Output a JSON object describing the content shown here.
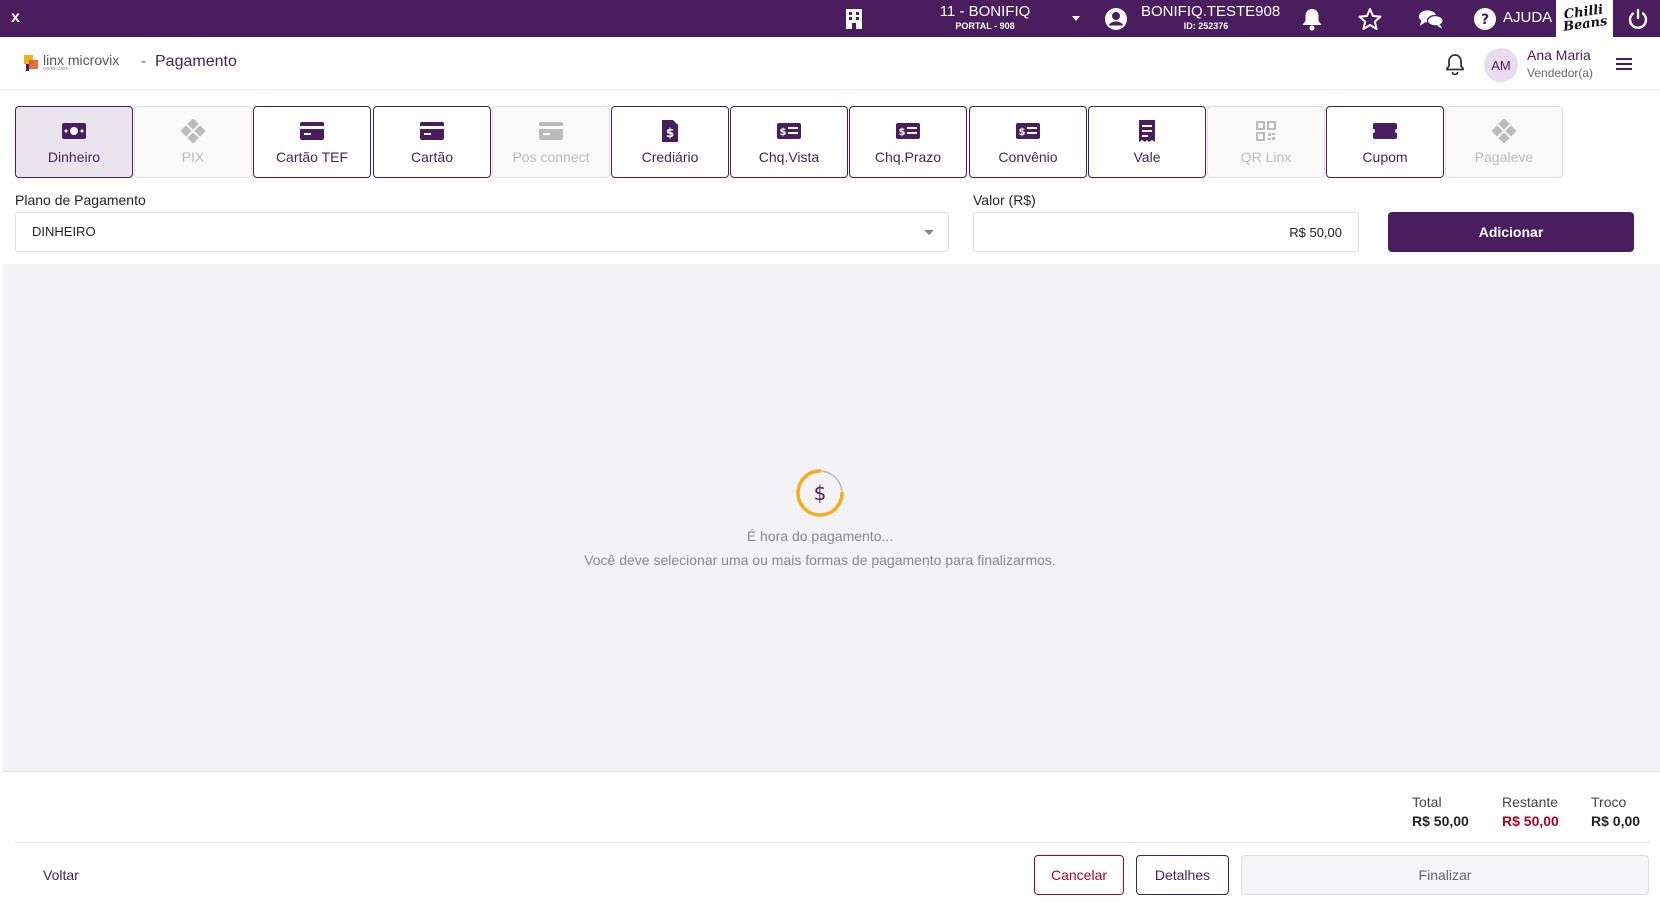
{
  "topbar": {
    "close_label": "x",
    "store_title": "11 - BONIFIQ",
    "store_sub": "PORTAL - 908",
    "user_title": "BONIFIQ.TESTE908",
    "user_sub": "ID: 252376",
    "help_label": "AJUDA",
    "brand_text": "Chilli Beans",
    "icons": [
      "building-icon",
      "account-circle-icon",
      "bell-icon",
      "star-icon",
      "chat-icon",
      "help-icon",
      "power-icon"
    ]
  },
  "header": {
    "logo_text": "linx microvix",
    "logo_sub": "world-class",
    "separator": "-",
    "page_title": "Pagamento",
    "avatar_initials": "AM",
    "user_name": "Ana Maria",
    "user_role": "Vendedor(a)"
  },
  "methods": [
    {
      "label": "Dinheiro",
      "icon": "cash-icon",
      "state": "active"
    },
    {
      "label": "PIX",
      "icon": "pix-icon",
      "state": "disabled"
    },
    {
      "label": "Cartão TEF",
      "icon": "credit-card-icon",
      "state": "enabled"
    },
    {
      "label": "Cartão",
      "icon": "credit-card-icon",
      "state": "enabled"
    },
    {
      "label": "Pos connect",
      "icon": "credit-card-icon",
      "state": "disabled"
    },
    {
      "label": "Crediário",
      "icon": "invoice-icon",
      "state": "enabled"
    },
    {
      "label": "Chq.Vista",
      "icon": "check-money-icon",
      "state": "enabled"
    },
    {
      "label": "Chq.Prazo",
      "icon": "check-money-icon",
      "state": "enabled"
    },
    {
      "label": "Convênio",
      "icon": "check-money-icon",
      "state": "enabled"
    },
    {
      "label": "Vale",
      "icon": "receipt-icon",
      "state": "enabled"
    },
    {
      "label": "QR Linx",
      "icon": "qr-code-icon",
      "state": "disabled"
    },
    {
      "label": "Cupom",
      "icon": "ticket-icon",
      "state": "enabled"
    },
    {
      "label": "Pagaleve",
      "icon": "pix-icon",
      "state": "disabled"
    }
  ],
  "form": {
    "plan_label": "Plano de Pagamento",
    "plan_value": "DINHEIRO",
    "value_label": "Valor (R$)",
    "value": "R$ 50,00",
    "add_label": "Adicionar"
  },
  "empty_state": {
    "title": "É hora do pagamento...",
    "subtitle": "Você deve selecionar uma ou mais formas de pagamento para finalizarmos."
  },
  "totals": {
    "total_label": "Total",
    "total_value": "R$ 50,00",
    "remaining_label": "Restante",
    "remaining_value": "R$ 50,00",
    "change_label": "Troco",
    "change_value": "R$ 0,00"
  },
  "footer": {
    "back_label": "Voltar",
    "cancel_label": "Cancelar",
    "details_label": "Detalhes",
    "finish_label": "Finalizar"
  },
  "colors": {
    "primary": "#4a1e5e",
    "danger": "#b00020",
    "accent_gold": "#f2b01e"
  }
}
